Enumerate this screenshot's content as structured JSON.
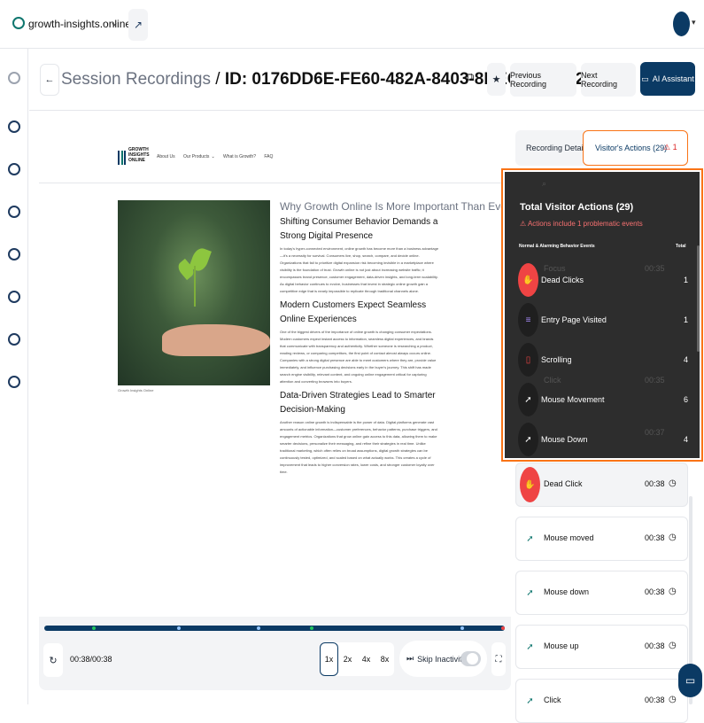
{
  "topbar": {
    "site_name": "growth-insights.online",
    "chevron": "⌄"
  },
  "header": {
    "breadcrumb": "Session Recordings",
    "separator": " / ",
    "recording_id": "ID: 0176DD6E-FE60-482A-8403-8BEC89131627",
    "prev_label": "Previous Recording",
    "next_label": "Next Recording",
    "ai_label": "AI Assistant"
  },
  "site": {
    "logo_text": "GROWTH INSIGHTS ONLINE",
    "nav": [
      "About Us",
      "Our Products",
      "What is Growth?",
      "FAQ"
    ],
    "caption": "Growth Insights Online",
    "kicker": "Why Growth Online Is More Important Than Ever",
    "h1": "Shifting Consumer Behavior Demands a Strong Digital Presence",
    "p1": "In today's hyper-connected environment, online growth has become more than a business advantage—it's a necessity for survival. Consumers live, shop, search, compare, and decide online. Organizations that fail to prioritize digital expansion risk becoming invisible in a marketplace where visibility is the foundation of trust. Growth online is not just about increasing website traffic; it encompasses brand presence, customer engagement, data-driven insights, and long-term scalability. As digital behavior continues to evolve, businesses that invest in strategic online growth gain a competitive edge that is nearly impossible to replicate through traditional channels alone.",
    "h2": "Modern Customers Expect Seamless Online Experiences",
    "p2": "One of the biggest drivers of the importance of online growth is changing consumer expectations. Modern customers expect instant access to information, seamless digital experiences, and brands that communicate with transparency and authenticity. Whether someone is researching a product, reading reviews, or comparing competitors, the first point of contact almost always occurs online. Companies with a strong digital presence are able to meet customers where they are, provide value immediately, and influence purchasing decisions early in the buyer's journey. This shift has made search engine visibility, relevant content, and ongoing online engagement critical for capturing attention and converting browsers into buyers.",
    "h3": "Data-Driven Strategies Lead to Smarter Decision-Making",
    "p3": "Another reason online growth is indispensable is the power of data. Digital platforms generate vast amounts of actionable information—customer preferences, behavior patterns, purchase triggers, and engagement metrics. Organizations that grow online gain access to this data, allowing them to make smarter decisions, personalize their messaging, and refine their strategies in real time. Unlike traditional marketing, which often relies on broad assumptions, digital growth strategies can be continuously tested, optimized, and scaled based on what actually works. This creates a cycle of improvement that leads to higher conversion rates, lower costs, and stronger customer loyalty over time."
  },
  "player": {
    "time": "00:38/00:38",
    "speeds": [
      "1x",
      "2x",
      "4x",
      "8x"
    ],
    "skip_label": "Skip Inactivity",
    "skip_enabled": false
  },
  "tabs": {
    "details": "Recording Details",
    "actions": "Visitor's Actions (29)",
    "alert_count": "1"
  },
  "popup": {
    "title": "Total Visitor Actions (29)",
    "warning": "Actions include 1 problematic events",
    "col_type": "Normal & Alarming Behavior Events",
    "col_total": "Total",
    "rows": [
      {
        "label": "Dead Clicks",
        "count": "1",
        "color": "#ef4444",
        "icon": "dead-click-icon"
      },
      {
        "label": "Entry Page Visited",
        "count": "1",
        "color": "#1f1f1f",
        "icon": "entry-page-icon"
      },
      {
        "label": "Scrolling",
        "count": "4",
        "color": "#1f1f1f",
        "icon": "scroll-icon"
      },
      {
        "label": "Mouse Movement",
        "count": "6",
        "color": "#1f1f1f",
        "icon": "mouse-move-icon"
      },
      {
        "label": "Mouse Down",
        "count": "4",
        "color": "#1f1f1f",
        "icon": "mouse-down-icon"
      }
    ],
    "ghost": [
      "Focus",
      "00:35",
      "Click",
      "00:35",
      "00:37"
    ]
  },
  "actions": [
    {
      "label": "Dead Click",
      "time": "00:38",
      "highlight": true,
      "icon": "dead-click-icon"
    },
    {
      "label": "Mouse moved",
      "time": "00:38",
      "highlight": false,
      "icon": "mouse-move-icon"
    },
    {
      "label": "Mouse down",
      "time": "00:38",
      "highlight": false,
      "icon": "mouse-down-icon"
    },
    {
      "label": "Mouse up",
      "time": "00:38",
      "highlight": false,
      "icon": "mouse-up-icon"
    },
    {
      "label": "Click",
      "time": "00:38",
      "highlight": false,
      "icon": "click-icon"
    }
  ]
}
